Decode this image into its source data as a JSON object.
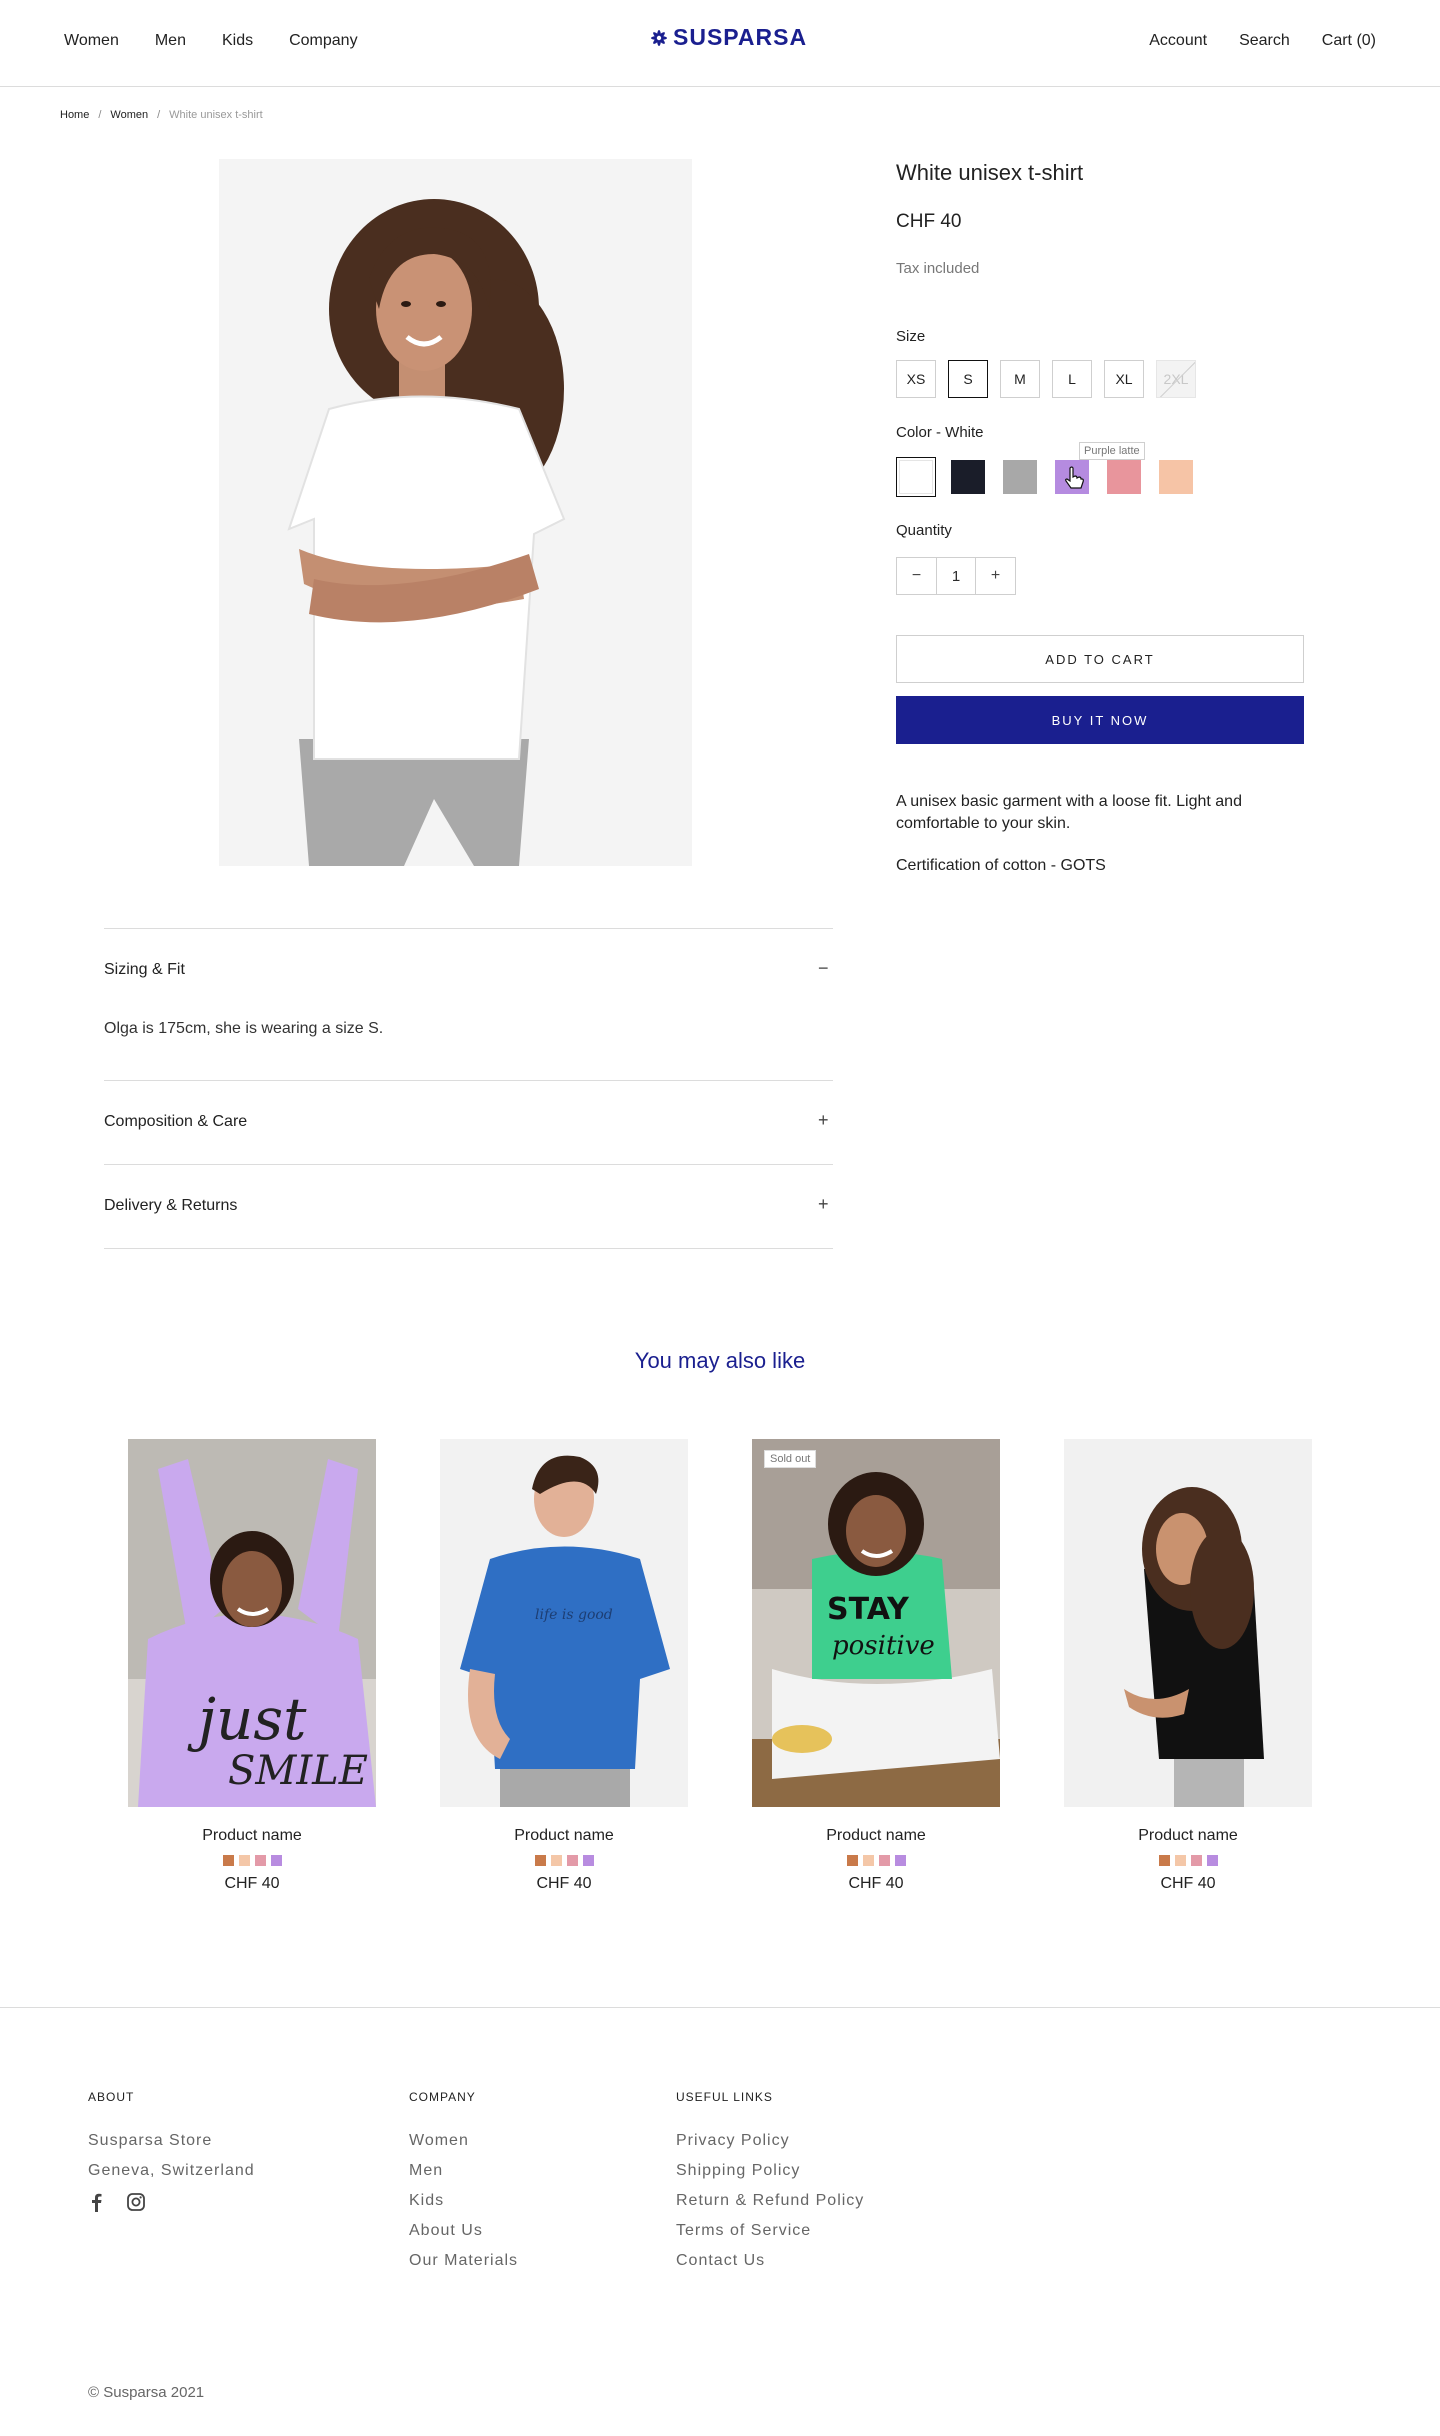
{
  "header": {
    "nav_left": [
      "Women",
      "Men",
      "Kids",
      "Company"
    ],
    "brand": "SUSPARSA",
    "nav_right": [
      "Account",
      "Search",
      "Cart (0)"
    ]
  },
  "breadcrumb": [
    "Home",
    "Women",
    "White unisex t-shirt"
  ],
  "product": {
    "title": "White unisex t-shirt",
    "price": "CHF 40",
    "tax_note": "Tax included",
    "size_label": "Size",
    "sizes": [
      "XS",
      "S",
      "M",
      "L",
      "XL",
      "2XL"
    ],
    "selected_size": "S",
    "unavailable_size": "2XL",
    "color_label": "Color - White",
    "colors": [
      "#ffffff",
      "#1a1d29",
      "#a8a8a8",
      "#b58be0",
      "#e8959c",
      "#f6c4a6"
    ],
    "selected_color": "#ffffff",
    "hover_tooltip": "Purple latte",
    "quantity_label": "Quantity",
    "quantity": "1",
    "add_to_cart": "ADD TO CART",
    "buy_now": "BUY IT NOW",
    "description": "A unisex basic garment with a loose fit. Light and comfortable to your skin.",
    "certification": "Certification of cotton - GOTS"
  },
  "accordion": [
    {
      "title": "Sizing & Fit",
      "open": true,
      "content": "Olga is 175cm, she is wearing a size S."
    },
    {
      "title": "Composition & Care",
      "open": false
    },
    {
      "title": "Delivery & Returns",
      "open": false
    }
  ],
  "recommendations": {
    "title": "You may also like",
    "swatch_colors": [
      "#c97a4a",
      "#f4c7a8",
      "#e39aa8",
      "#b88ce0"
    ],
    "badge": "Sold out",
    "items": [
      {
        "name": "Product name",
        "price": "CHF 40"
      },
      {
        "name": "Product name",
        "price": "CHF 40"
      },
      {
        "name": "Product name",
        "price": "CHF 40"
      },
      {
        "name": "Product name",
        "price": "CHF 40"
      }
    ]
  },
  "footer": {
    "about_head": "ABOUT",
    "about": [
      "Susparsa Store",
      "Geneva, Switzerland"
    ],
    "company_head": "COMPANY",
    "company_links": [
      "Women",
      "Men",
      "Kids",
      "About Us",
      "Our Materials"
    ],
    "useful_head": "USEFUL LINKS",
    "useful_links": [
      "Privacy Policy",
      "Shipping Policy",
      "Return & Refund Policy",
      "Terms of Service",
      "Contact Us"
    ],
    "copyright": "© Susparsa 2021"
  },
  "colors": {
    "accent": "#1a1f8f"
  }
}
